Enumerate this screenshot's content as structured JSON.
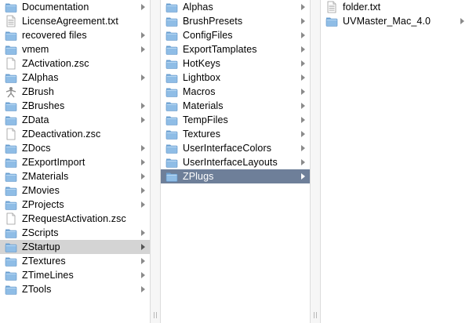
{
  "columns": [
    {
      "selected_index": 17,
      "selected_style": "gray",
      "items": [
        {
          "label": "Documentation",
          "icon": "folder-icon",
          "has_children": true
        },
        {
          "label": "LicenseAgreement.txt",
          "icon": "text-document-icon",
          "has_children": false
        },
        {
          "label": "recovered files",
          "icon": "folder-icon",
          "has_children": true
        },
        {
          "label": "vmem",
          "icon": "folder-icon",
          "has_children": true
        },
        {
          "label": "ZActivation.zsc",
          "icon": "document-icon",
          "has_children": false
        },
        {
          "label": "ZAlphas",
          "icon": "folder-icon",
          "has_children": true
        },
        {
          "label": "ZBrush",
          "icon": "zbrush-app-icon",
          "has_children": false
        },
        {
          "label": "ZBrushes",
          "icon": "folder-icon",
          "has_children": true
        },
        {
          "label": "ZData",
          "icon": "folder-icon",
          "has_children": true
        },
        {
          "label": "ZDeactivation.zsc",
          "icon": "document-icon",
          "has_children": false
        },
        {
          "label": "ZDocs",
          "icon": "folder-icon",
          "has_children": true
        },
        {
          "label": "ZExportImport",
          "icon": "folder-icon",
          "has_children": true
        },
        {
          "label": "ZMaterials",
          "icon": "folder-icon",
          "has_children": true
        },
        {
          "label": "ZMovies",
          "icon": "folder-icon",
          "has_children": true
        },
        {
          "label": "ZProjects",
          "icon": "folder-icon",
          "has_children": true
        },
        {
          "label": "ZRequestActivation.zsc",
          "icon": "document-icon",
          "has_children": false
        },
        {
          "label": "ZScripts",
          "icon": "folder-icon",
          "has_children": true
        },
        {
          "label": "ZStartup",
          "icon": "folder-icon",
          "has_children": true
        },
        {
          "label": "ZTextures",
          "icon": "folder-icon",
          "has_children": true
        },
        {
          "label": "ZTimeLines",
          "icon": "folder-icon",
          "has_children": true
        },
        {
          "label": "ZTools",
          "icon": "folder-icon",
          "has_children": true
        }
      ]
    },
    {
      "selected_index": 12,
      "selected_style": "blue",
      "items": [
        {
          "label": "Alphas",
          "icon": "folder-icon",
          "has_children": true
        },
        {
          "label": "BrushPresets",
          "icon": "folder-icon",
          "has_children": true
        },
        {
          "label": "ConfigFiles",
          "icon": "folder-icon",
          "has_children": true
        },
        {
          "label": "ExportTamplates",
          "icon": "folder-icon",
          "has_children": true
        },
        {
          "label": "HotKeys",
          "icon": "folder-icon",
          "has_children": true
        },
        {
          "label": "Lightbox",
          "icon": "folder-icon",
          "has_children": true
        },
        {
          "label": "Macros",
          "icon": "folder-icon",
          "has_children": true
        },
        {
          "label": "Materials",
          "icon": "folder-icon",
          "has_children": true
        },
        {
          "label": "TempFiles",
          "icon": "folder-icon",
          "has_children": true
        },
        {
          "label": "Textures",
          "icon": "folder-icon",
          "has_children": true
        },
        {
          "label": "UserInterfaceColors",
          "icon": "folder-icon",
          "has_children": true
        },
        {
          "label": "UserInterfaceLayouts",
          "icon": "folder-icon",
          "has_children": true
        },
        {
          "label": "ZPlugs",
          "icon": "folder-icon",
          "has_children": true
        }
      ]
    },
    {
      "selected_index": -1,
      "selected_style": "none",
      "items": [
        {
          "label": "folder.txt",
          "icon": "text-document-icon",
          "has_children": false
        },
        {
          "label": "UVMaster_Mac_4.0",
          "icon": "folder-icon",
          "has_children": true
        }
      ]
    }
  ],
  "colors": {
    "folder_body": "#8fbde6",
    "folder_tab": "#6fa3d3",
    "selection_gray": "#d4d4d4",
    "selection_blue": "#6e7f99"
  }
}
